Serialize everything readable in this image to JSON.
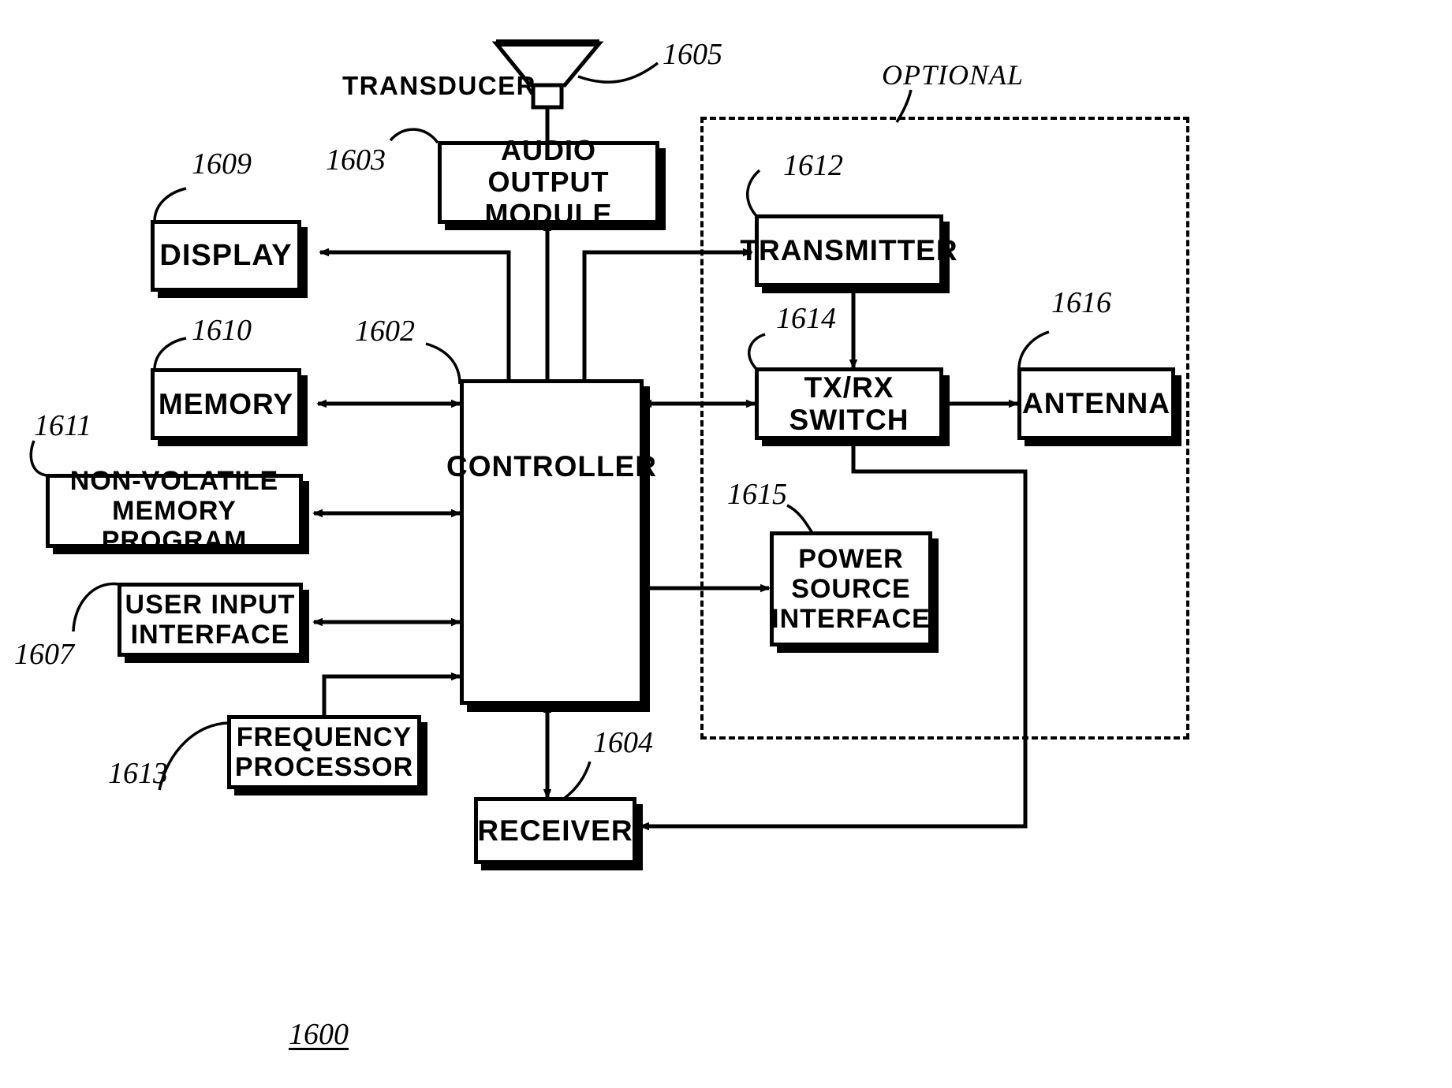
{
  "figure": {
    "number": "1600",
    "optional_label": "OPTIONAL",
    "transducer_label": "TRANSDUCER"
  },
  "blocks": [
    {
      "id": "audio_output_module",
      "label": "AUDIO  OUTPUT\nMODULE",
      "ref": "1603"
    },
    {
      "id": "display",
      "label": "DISPLAY",
      "ref": "1609"
    },
    {
      "id": "memory",
      "label": "MEMORY",
      "ref": "1610"
    },
    {
      "id": "nonvolatile_memory",
      "label": "NON-VOLATILE\nMEMORY  PROGRAM",
      "ref": "1611"
    },
    {
      "id": "user_input_interface",
      "label": "USER  INPUT\nINTERFACE",
      "ref": "1607"
    },
    {
      "id": "frequency_processor",
      "label": "FREQUENCY\nPROCESSOR",
      "ref": "1613"
    },
    {
      "id": "controller",
      "label": "CONTROLLER",
      "ref": "1602"
    },
    {
      "id": "receiver",
      "label": "RECEIVER",
      "ref": "1604"
    },
    {
      "id": "transmitter",
      "label": "TRANSMITTER",
      "ref": "1612"
    },
    {
      "id": "tx_rx_switch",
      "label": "TX/RX\nSWITCH",
      "ref": "1614"
    },
    {
      "id": "antenna",
      "label": "ANTENNA",
      "ref": "1616"
    },
    {
      "id": "power_source_interface",
      "label": "POWER\nSOURCE\nINTERFACE",
      "ref": "1615"
    }
  ],
  "transducer": {
    "ref": "1605"
  },
  "refs": {
    "r1600": "1600",
    "r1602": "1602",
    "r1603": "1603",
    "r1604": "1604",
    "r1605": "1605",
    "r1607": "1607",
    "r1609": "1609",
    "r1610": "1610",
    "r1611": "1611",
    "r1612": "1612",
    "r1613": "1613",
    "r1614": "1614",
    "r1615": "1615",
    "r1616": "1616"
  },
  "labels": {
    "transducer": "TRANSDUCER",
    "optional": "OPTIONAL",
    "audio_output_module": "AUDIO  OUTPUT\nMODULE",
    "display": "DISPLAY",
    "memory": "MEMORY",
    "nonvolatile_memory": "NON-VOLATILE\nMEMORY  PROGRAM",
    "user_input_interface": "USER  INPUT\nINTERFACE",
    "frequency_processor": "FREQUENCY\nPROCESSOR",
    "controller": "CONTROLLER",
    "receiver": "RECEIVER",
    "transmitter": "TRANSMITTER",
    "tx_rx_switch": "TX/RX\nSWITCH",
    "antenna": "ANTENNA",
    "power_source_interface": "POWER\nSOURCE\nINTERFACE"
  },
  "colors": {
    "ink": "#000000",
    "paper": "#ffffff"
  }
}
